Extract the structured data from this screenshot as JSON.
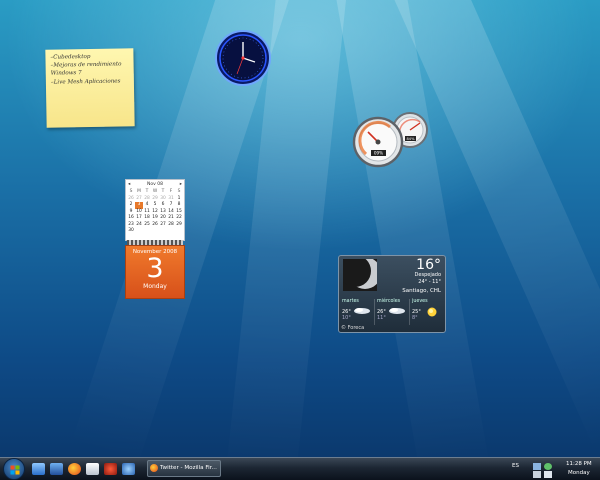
{
  "sticky_note": {
    "lines": [
      "–Cubedesktop",
      "–Mejoras de rendimiento",
      "Windows 7",
      "–Live Mesh Aplicaciones"
    ]
  },
  "calendar": {
    "month_header": "Nov 08",
    "weekdays": [
      "S",
      "M",
      "T",
      "W",
      "T",
      "F",
      "S"
    ],
    "rows": [
      [
        "26",
        "27",
        "28",
        "29",
        "30",
        "31",
        "1"
      ],
      [
        "2",
        "3",
        "4",
        "5",
        "6",
        "7",
        "8"
      ],
      [
        "9",
        "10",
        "11",
        "12",
        "13",
        "14",
        "15"
      ],
      [
        "16",
        "17",
        "18",
        "19",
        "20",
        "21",
        "22"
      ],
      [
        "23",
        "24",
        "25",
        "26",
        "27",
        "28",
        "29"
      ],
      [
        "30",
        "",
        "",
        "",
        "",
        "",
        ""
      ]
    ],
    "today": "3",
    "month_year": "November 2008",
    "day_number": "3",
    "day_name": "Monday"
  },
  "weather": {
    "temperature": "16°",
    "condition": "Despejado",
    "range": "24° - 11°",
    "city": "Santiago, CHL",
    "forecast": [
      {
        "day": "martes",
        "high": "26°",
        "low": "10°",
        "icon": "cloudy-icon"
      },
      {
        "day": "miércoles",
        "high": "26°",
        "low": "11°",
        "icon": "cloudy-icon"
      },
      {
        "day": "jueves",
        "high": "25°",
        "low": "8°",
        "icon": "sun-icon"
      }
    ],
    "source": "© Foreca"
  },
  "cpu_meter": {
    "cpu_percent": "09%",
    "ram_percent": "84%"
  },
  "taskbar": {
    "window_button_label": "Twitter - Mozilla Fir...",
    "language": "ES",
    "time": "11:28 PM",
    "day": "Monday"
  },
  "colors": {
    "desktop_top": "#2a9cc4",
    "desktop_bottom": "#0a3568",
    "calendar_orange": "#e8792a",
    "sticky_yellow": "#f7e58a"
  }
}
